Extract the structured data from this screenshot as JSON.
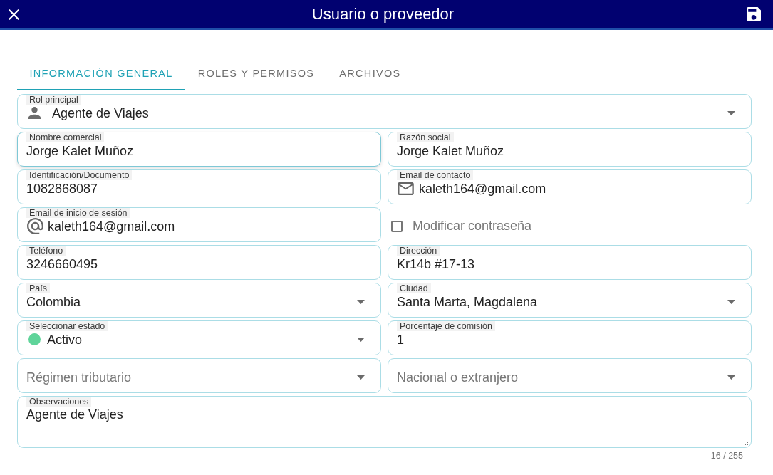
{
  "window": {
    "title": "Usuario o proveedor"
  },
  "tabs": [
    {
      "label": "INFORMACIÓN GENERAL",
      "selected": true
    },
    {
      "label": "ROLES Y PERMISOS",
      "selected": false
    },
    {
      "label": "ARCHIVOS",
      "selected": false
    }
  ],
  "form": {
    "rows": [
      {
        "fields": [
          {
            "kind": "select",
            "label": "Rol principal",
            "value": "Agente de Viajes",
            "focused": false
          }
        ]
      },
      {
        "fields": [
          {
            "kind": "text",
            "label": "Nombre comercial",
            "value": "Jorge Kalet Muñoz",
            "focused": true
          },
          {
            "kind": "text",
            "label": "Razón social",
            "value": "Jorge Kalet Muñoz",
            "focused": false
          }
        ]
      },
      {
        "fields": [
          {
            "kind": "text",
            "label": "Identificación/Documento",
            "value": "1082868087",
            "focused": false
          },
          {
            "kind": "text",
            "label": "Email de contacto",
            "value": "kaleth164@gmail.com",
            "focused": false
          }
        ]
      },
      {
        "fields": [
          {
            "kind": "text",
            "label": "Email de inicio de sesión",
            "value": "kaleth164@gmail.com",
            "focused": false
          },
          {
            "kind": "checkbox",
            "label": "Modificar contraseña",
            "checked": false
          }
        ]
      },
      {
        "fields": [
          {
            "kind": "text",
            "label": "Teléfono",
            "value": "3246660495",
            "focused": false
          },
          {
            "kind": "text",
            "label": "Dirección",
            "value": "Kr14b #17-13",
            "focused": false
          }
        ]
      },
      {
        "fields": [
          {
            "kind": "select",
            "label": "País",
            "value": "Colombia",
            "focused": false
          },
          {
            "kind": "select",
            "label": "Ciudad",
            "value": "Santa Marta, Magdalena",
            "focused": false
          }
        ]
      },
      {
        "fields": [
          {
            "kind": "select",
            "label": "Seleccionar estado",
            "value": "Activo",
            "color": "#5fd49a",
            "focused": false
          },
          {
            "kind": "text",
            "label": "Porcentaje de comisión",
            "value": "1",
            "focused": false
          }
        ]
      },
      {
        "fields": [
          {
            "kind": "select",
            "placeholder": "Régimen tributario",
            "focused": false
          },
          {
            "kind": "select",
            "placeholder": "Nacional o extranjero",
            "focused": false
          }
        ]
      },
      {
        "fields": [
          {
            "kind": "textarea",
            "label": "Observaciones",
            "value": "Agente de Viajes",
            "counter": "16 / 255",
            "focused": false
          }
        ]
      }
    ]
  }
}
